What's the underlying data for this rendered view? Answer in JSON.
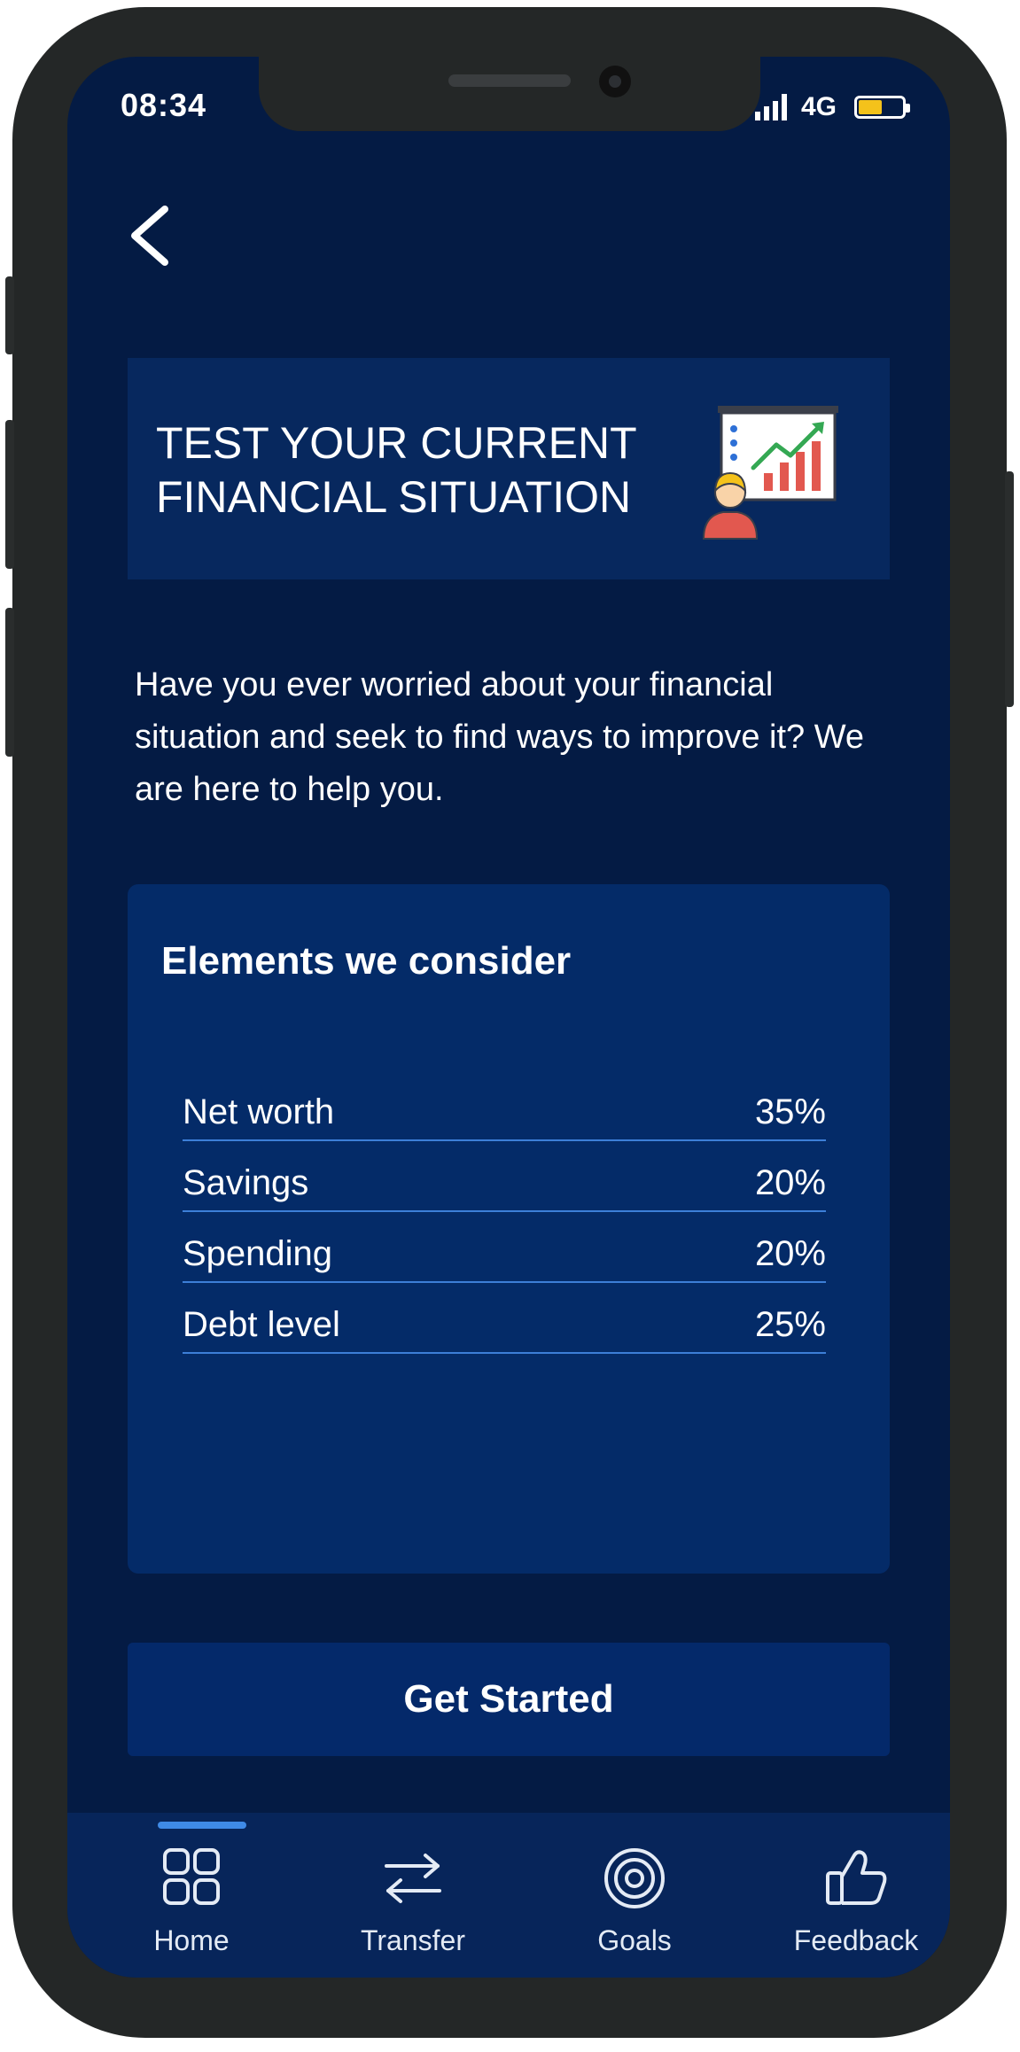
{
  "status_bar": {
    "time": "08:34",
    "network": "4G",
    "battery_color": "#f4c21b"
  },
  "header": {
    "back_icon": "chevron-left-icon"
  },
  "banner": {
    "title": "TEST YOUR CURRENT\nFINANCIAL SITUATION",
    "illustration_icon": "presentation-chart-icon"
  },
  "intro": {
    "text": "Have you ever worried about your financial situation and seek to find ways to improve it? We are here to help you."
  },
  "elements_card": {
    "title": "Elements we consider",
    "items": [
      {
        "label": "Net worth",
        "value": "35%"
      },
      {
        "label": "Savings",
        "value": "20%"
      },
      {
        "label": "Spending",
        "value": "20%"
      },
      {
        "label": "Debt level",
        "value": "25%"
      }
    ]
  },
  "cta": {
    "label": "Get Started"
  },
  "tab_bar": {
    "active_index": 0,
    "accent_color": "#3f8ae6",
    "tabs": [
      {
        "label": "Home",
        "icon": "grid-icon"
      },
      {
        "label": "Transfer",
        "icon": "transfer-arrows-icon"
      },
      {
        "label": "Goals",
        "icon": "target-icon"
      },
      {
        "label": "Feedback",
        "icon": "thumbs-up-icon"
      }
    ]
  },
  "colors": {
    "background": "#041b44",
    "card": "#042b68",
    "divider": "#3d7fd8"
  }
}
